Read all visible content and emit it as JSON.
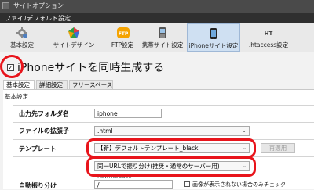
{
  "window": {
    "title": "サイトオプション"
  },
  "menu": [
    {
      "label": "ファイル"
    },
    {
      "label": "デフォルト設定"
    }
  ],
  "toolbar": {
    "items": [
      {
        "label": "基本設定",
        "icon": "gear-icon"
      },
      {
        "label": "サイトデザイン",
        "icon": "palette-icon"
      },
      {
        "label": "FTP設定",
        "icon": "ftp-icon"
      },
      {
        "label": "携帯サイト設定",
        "icon": "mobile-phone-icon"
      },
      {
        "label": "iPhoneサイト設定",
        "icon": "iphone-icon"
      },
      {
        "label": ".htaccess設定",
        "icon": "ht-icon"
      }
    ],
    "ftp_icon_text": "FTP",
    "ht_icon_text": "HT",
    "active": "iPhoneサイト設定"
  },
  "section": {
    "checkbox_checked": true,
    "heading": "iPhoneサイトを同時生成する"
  },
  "tabs": [
    {
      "label": "基本設定"
    },
    {
      "label": "詳細設定"
    },
    {
      "label": "フリースペース"
    }
  ],
  "group": {
    "label": "基本設定"
  },
  "form": {
    "output_folder": {
      "label": "出力先フォルダ名",
      "value": "iphone"
    },
    "extension": {
      "label": "ファイルの拡張子",
      "value": ".html"
    },
    "template": {
      "label": "テンプレート",
      "value": "【新】デフォルトテンプレート_black",
      "button": "再適用"
    },
    "auto_split": {
      "label": "自動振り分け",
      "value": "同一URLで振り分け(推奨・通常のサーバー用)",
      "sub_value": "RewriteBase",
      "path_value": "/"
    },
    "image_check": {
      "label": "画像が表示されない場合のみチェック"
    }
  },
  "colors": {
    "highlight": "#e8141b",
    "titlebar": "#4a4a4a",
    "menubar": "#2f2f2f",
    "active_tab": "#cfe0f2"
  }
}
